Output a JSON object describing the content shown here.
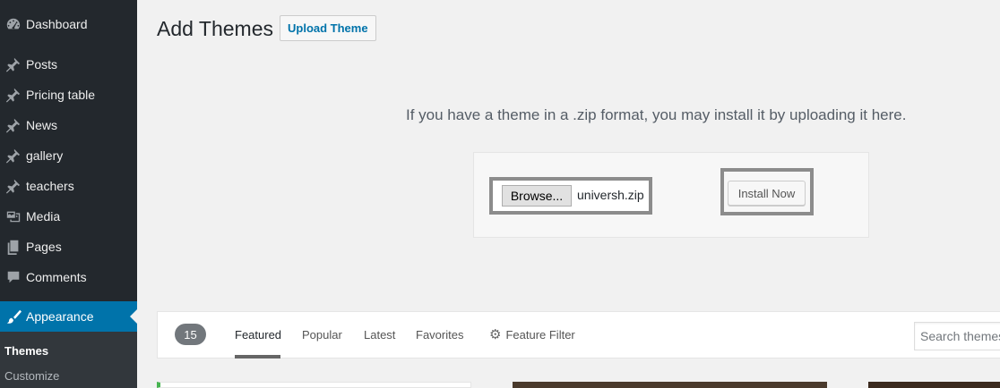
{
  "sidebar": {
    "items": [
      {
        "label": "Dashboard",
        "icon": "dashboard-icon"
      },
      {
        "label": "Posts",
        "icon": "pin-icon"
      },
      {
        "label": "Pricing table",
        "icon": "pin-icon"
      },
      {
        "label": "News",
        "icon": "pin-icon"
      },
      {
        "label": "gallery",
        "icon": "pin-icon"
      },
      {
        "label": "teachers",
        "icon": "pin-icon"
      },
      {
        "label": "Media",
        "icon": "media-icon"
      },
      {
        "label": "Pages",
        "icon": "pages-icon"
      },
      {
        "label": "Comments",
        "icon": "comment-icon"
      },
      {
        "label": "Appearance",
        "icon": "brush-icon",
        "active": true
      }
    ],
    "submenu": [
      {
        "label": "Themes",
        "current": true
      },
      {
        "label": "Customize"
      }
    ],
    "active_color": "#0073aa"
  },
  "header": {
    "title": "Add Themes",
    "upload_button": "Upload Theme"
  },
  "upload": {
    "description": "If you have a theme in a .zip format, you may install it by uploading it here.",
    "browse_label": "Browse...",
    "file_name": "universh.zip",
    "install_label": "Install Now"
  },
  "filter": {
    "count": "15",
    "tabs": [
      {
        "label": "Featured",
        "current": true
      },
      {
        "label": "Popular"
      },
      {
        "label": "Latest"
      },
      {
        "label": "Favorites"
      }
    ],
    "feature_filter": "Feature Filter",
    "search_placeholder": "Search themes..."
  }
}
